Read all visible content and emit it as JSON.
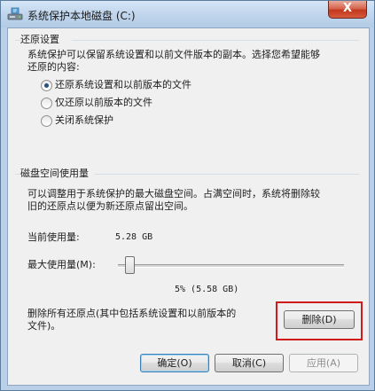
{
  "window": {
    "title": "系统保护本地磁盘 (C:)",
    "close_label": "X"
  },
  "restore": {
    "group_title": "还原设置",
    "description_line1": "系统保护可以保留系统设置和以前文件版本的副本。选择您希望能够",
    "description_line2": "还原的内容:",
    "options": [
      {
        "label": "还原系统设置和以前版本的文件",
        "selected": true
      },
      {
        "label": "仅还原以前版本的文件",
        "selected": false
      },
      {
        "label": "关闭系统保护",
        "selected": false
      }
    ]
  },
  "disk": {
    "group_title": "磁盘空间使用量",
    "description_line1": "可以调整用于系统保护的最大磁盘空间。占满空间时，系统将删除较",
    "description_line2": "旧的还原点以便为新还原点留出空间。",
    "current_label": "当前使用量:",
    "current_value": "5.28 GB",
    "max_label": "最大使用量(M):",
    "slider_level_percent": 5,
    "slider_readout": "5% (5.58 GB)",
    "delete_text_line1": "删除所有还原点(其中包括系统设置和以前版本的",
    "delete_text_line2": "文件)。",
    "delete_button": "删除(D)"
  },
  "footer": {
    "ok": "确定(O)",
    "cancel": "取消(C)",
    "apply": "应用(A)"
  },
  "colors": {
    "highlight": "#d11a1a",
    "radio_dot": "#2a4f7a",
    "close_button": "#c2381c"
  }
}
